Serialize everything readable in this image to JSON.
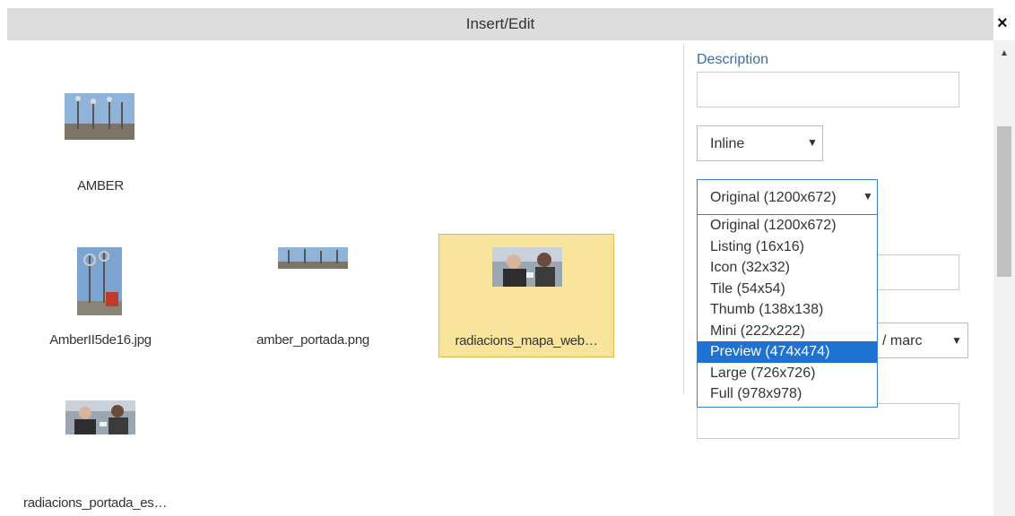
{
  "dialog": {
    "title": "Insert/Edit",
    "close_label": "×"
  },
  "gallery": {
    "items": [
      {
        "label": "AMBER",
        "thumb": "amber-thumbnail"
      },
      {
        "label": "AmberII5de16.jpg",
        "thumb": "amber-tower-thumbnail"
      },
      {
        "label": "amber_portada.png",
        "thumb": "amber-banner-thumbnail"
      },
      {
        "label": "radiacions_mapa_web…",
        "thumb": "radiacions-people-thumbnail",
        "selected": true
      },
      {
        "label": "radiacions_portada_es…",
        "thumb": "radiacions-portada-thumbnail"
      }
    ]
  },
  "panel": {
    "description_label": "Description",
    "description_value": "",
    "alignment_select": "Inline",
    "size_select": "Original (1200x672)",
    "partial_select_value": "/ marc",
    "size_options": [
      "Original (1200x672)",
      "Listing (16x16)",
      "Icon (32x32)",
      "Tile (54x54)",
      "Thumb (138x138)",
      "Mini (222x222)",
      "Preview (474x474)",
      "Large (726x726)",
      "Full (978x978)"
    ],
    "highlighted_option": "Preview (474x474)"
  },
  "colors": {
    "selected_tile_bg": "#f8e49a",
    "highlight_option_bg": "#1e73d2",
    "label_accent": "#3a6da8"
  }
}
